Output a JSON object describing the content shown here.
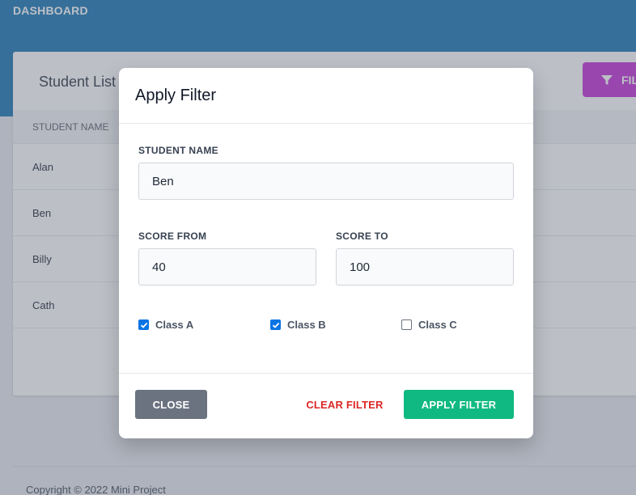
{
  "header": {
    "brand": "DASHBOARD",
    "color": "#0b6fb0"
  },
  "card": {
    "title": "Student List",
    "filter_button_label": "FIL",
    "filter_button_color": "#c026d3",
    "table": {
      "columns": [
        "STUDENT NAME"
      ],
      "rows": [
        "Alan",
        "Ben",
        "Billy",
        "Cath"
      ]
    }
  },
  "footer": {
    "copyright": "Copyright © 2022 Mini Project"
  },
  "modal": {
    "title": "Apply Filter",
    "student_name": {
      "label": "STUDENT NAME",
      "value": "Ben"
    },
    "score_from": {
      "label": "SCORE FROM",
      "value": "40"
    },
    "score_to": {
      "label": "SCORE TO",
      "value": "100"
    },
    "classes": [
      {
        "label": "Class A",
        "checked": true
      },
      {
        "label": "Class B",
        "checked": true
      },
      {
        "label": "Class C",
        "checked": false
      }
    ],
    "buttons": {
      "close": "CLOSE",
      "clear": "CLEAR FILTER",
      "apply": "APPLY FILTER"
    },
    "colors": {
      "apply": "#10b981",
      "clear": "#dc2626",
      "close": "#6b7280",
      "checkbox": "#0b74e4"
    }
  },
  "icons": [
    "filter-icon",
    "check-icon"
  ]
}
